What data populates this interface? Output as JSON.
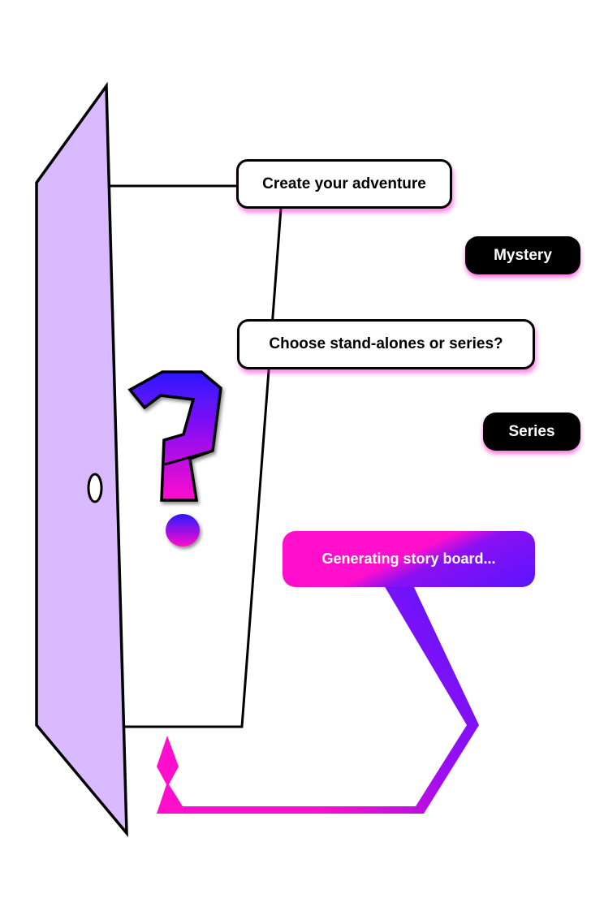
{
  "prompts": {
    "create": "Create your adventure",
    "choose": "Choose stand-alones or series?"
  },
  "options": {
    "mystery": "Mystery",
    "series": "Series"
  },
  "status": {
    "generating": "Generating story board..."
  },
  "colors": {
    "door": "#d9b9ff",
    "accent_pink": "#ff0fcc",
    "accent_blue": "#2b14ff",
    "accent_purple": "#8a10f2",
    "ink": "#000000"
  },
  "icons": {
    "question_mark": "question-mark-icon",
    "door_knob": "door-knob-icon",
    "door": "door-illustration",
    "ribbon": "ribbon-arrow"
  }
}
